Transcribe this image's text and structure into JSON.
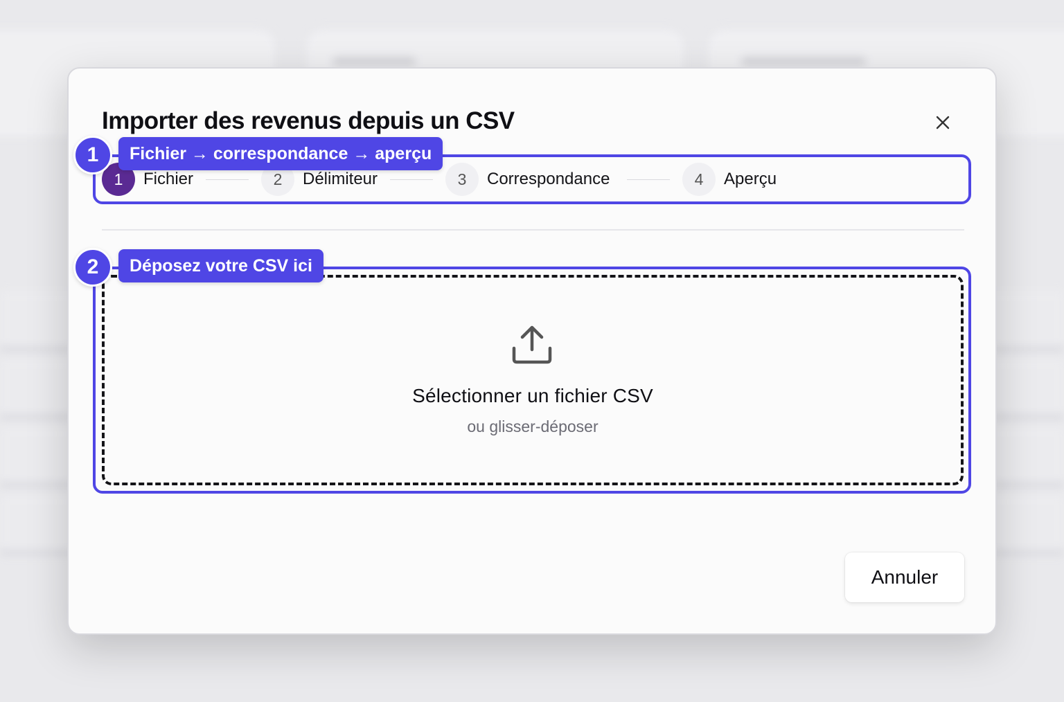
{
  "background": {
    "card_1_title": "",
    "card_2_title": "",
    "card_3_title": ""
  },
  "modal": {
    "title": "Importer des revenus depuis un CSV",
    "close_icon": "close-icon",
    "steps": [
      {
        "number": "1",
        "label": "Fichier",
        "active": true
      },
      {
        "number": "2",
        "label": "Délimiteur",
        "active": false
      },
      {
        "number": "3",
        "label": "Correspondance",
        "active": false
      },
      {
        "number": "4",
        "label": "Aperçu",
        "active": false
      }
    ],
    "dropzone": {
      "icon": "upload-icon",
      "title": "Sélectionner un fichier CSV",
      "subtitle": "ou glisser-déposer"
    },
    "cancel_label": "Annuler"
  },
  "annotations": [
    {
      "number": "1",
      "label": "Fichier → correspondance → aperçu"
    },
    {
      "number": "2",
      "label": "Déposez votre CSV ici"
    }
  ],
  "colors": {
    "accent": "#4f46e5",
    "active_step": "#5a2a93"
  }
}
